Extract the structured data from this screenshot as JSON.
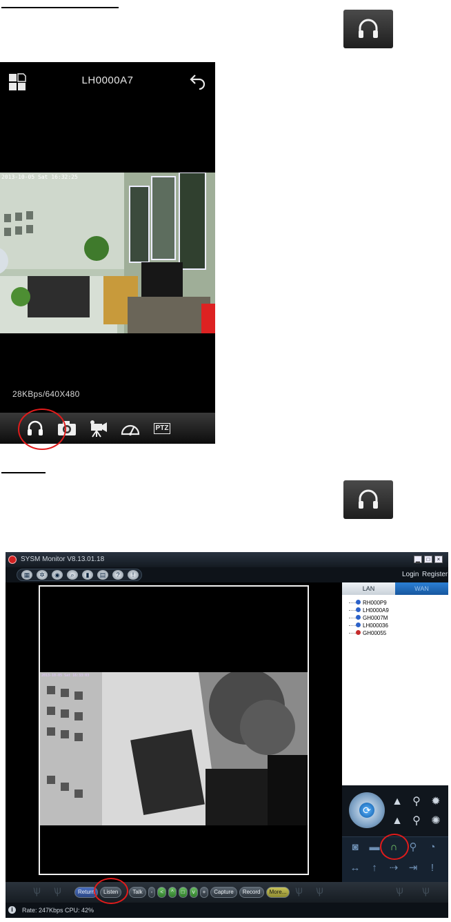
{
  "phone": {
    "title": "LH0000A7",
    "timestamp": "2013-10-05 Sat 16:32:25",
    "rate": "28KBps/640X480",
    "toolbar_ptz": "PTZ"
  },
  "desktop": {
    "title": "SYSM Monitor V8.13.01.18",
    "min_btn": "▁",
    "max_btn": "□",
    "close_btn": "×",
    "login": "Login",
    "register": "Register",
    "tab_lan": "LAN",
    "tab_wan": "WAN",
    "devices": [
      "RH000P9",
      "LH0000A9",
      "GH0007M",
      "LH000036",
      "GH00055"
    ],
    "bottom_buttons": {
      "return": "Return",
      "listen": "Listen",
      "talk": "Talk",
      "minus": "-",
      "left": "<",
      "up": "^",
      "stop": "□",
      "down": "v",
      "plus": "+",
      "capture": "Capture",
      "record": "Record",
      "more": "More..."
    },
    "status": "Rate: 247Kbps CPU: 42%",
    "video_timestamp": "2013-10-05 Sat 16:33:03"
  },
  "colors": {
    "highlight_circle": "#e21b1b",
    "wan_tab": "#2b7fd4"
  }
}
